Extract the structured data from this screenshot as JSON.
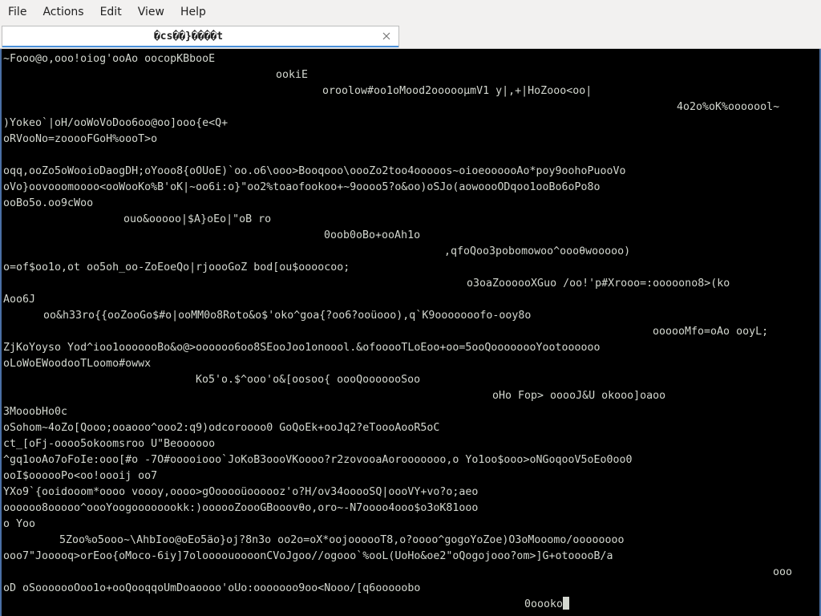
{
  "menubar": {
    "items": [
      "File",
      "Actions",
      "Edit",
      "View",
      "Help"
    ]
  },
  "tab": {
    "title": "�cs��}����t"
  },
  "terminal": {
    "lines": [
      "~Fooo@o,ooo!oiog'ooAo oocopKBbooE",
      "ookiE",
      "oroolow#oo1oMood2oooooμmV1 y|,+|HoZooo<oo|",
      "4o2o%oK%ooooool~",
      ")Yokeo`|oH/ooWoVoDoo6oo@oo]ooo{e<Q+",
      "oRVooNo=zooooFGoH%oooT>o",
      "",
      "oqq,ooZo5oWooioDaogDH;oYooo8{oOUoE)`oo.o6\\ooo>Booqooo\\oooZo2too4ooooos~oioeoooooAo*poy9oohoPuooVo",
      "oVo}oovooomoooo<ooWooKo%B'oK|~oo6i:o}\"oo2%toaofookoo+~9oooo5?o&oo)oSJo(aowoooODqoo1ooBo6oPo8o",
      "ooBo5o.oo9cWoo",
      "ouo&ooooo|$A}oEo|\"oB ro",
      "0oob0oBo+ooAh1o",
      ",qfoQoo3pobomowoo^oooθwooooo)",
      "o=of$oo1o,ot oo5oh_oo-ZoEoeQo|rjoooGoZ bod[ou$oooocoo;",
      "o3oaZoooooXGuo /oo!'p#Xrooo=:ooooono8>(ko",
      "Aoo6J",
      "oo&h33ro{{ooZooGo$#o|ooMM0o8Roto&o$'oko^goa{?oo6?ooüooo),q`K9ooooooofo-ooy8o",
      "oooooMfo=oAo ooyL;",
      "ZjKoYoyso Yod^ioo1ooooooBo&o@>oooooo6oo8SEooJoo1onoool.&ofooooTLoEoo+oo=5ooQoooooooYootoooooo",
      "oLoWoEWoodooTLoomo#owwx",
      "Ko5'o.$^ooo'o&[oosoo{ oooQooooooSoo",
      "oHo Fop> ooooJ&U okooo]oaoo",
      "3MooobHo0c",
      "oSohom~4oZo[Qooo;ooaooo^ooo2:q9)odcoroooo0 GoQoEk+ooJq2?eToooAooR5oC",
      "ct_[oFj-oooo5okoomsroo U\"Beoooooo",
      "^gq1ooAo7oFoIe:ooo[#o -7O#ooooiooo`JoKoB3oooVKoooo?r2zovooaAorooooooo,o Yo1oo$ooo>oNGoqooV5oEo0oo0",
      "ooI$oooooPo<oo!oooij oo7",
      "YXo9`{ooidooom*oooo voooy,oooo>gOooooüoooooz'o?H/ov34ooooSQ|oooVY+vo?o;aeo",
      "oooooo8ooooo^oooYoogoooooookk:)oooooZoooGBooovθo,oro~-N7oooo4ooo$o3oK81ooo",
      "o Yoo",
      "5Zoo%o5ooo~\\AhbIoo@oEo5äo}oj?8n3o oo2o=oX*oojoooooT8,o?oooo^gogoYoZoe)O3oMooomo/oooooooo",
      "ooo7\"Jooooq>orEoo{oMoco-6iy]7oloooouoooonCVoJgoo//ogooo`%ooL(UoHo&oe2\"oQogojooo?om>]G+otooooB/a",
      "ooo",
      "oD oSooooooOoo1o+ooQooqqoUmDoaoooo'oUo:ooooooo9oo<Nooo/[q6ooooobo",
      "0oooko"
    ]
  }
}
